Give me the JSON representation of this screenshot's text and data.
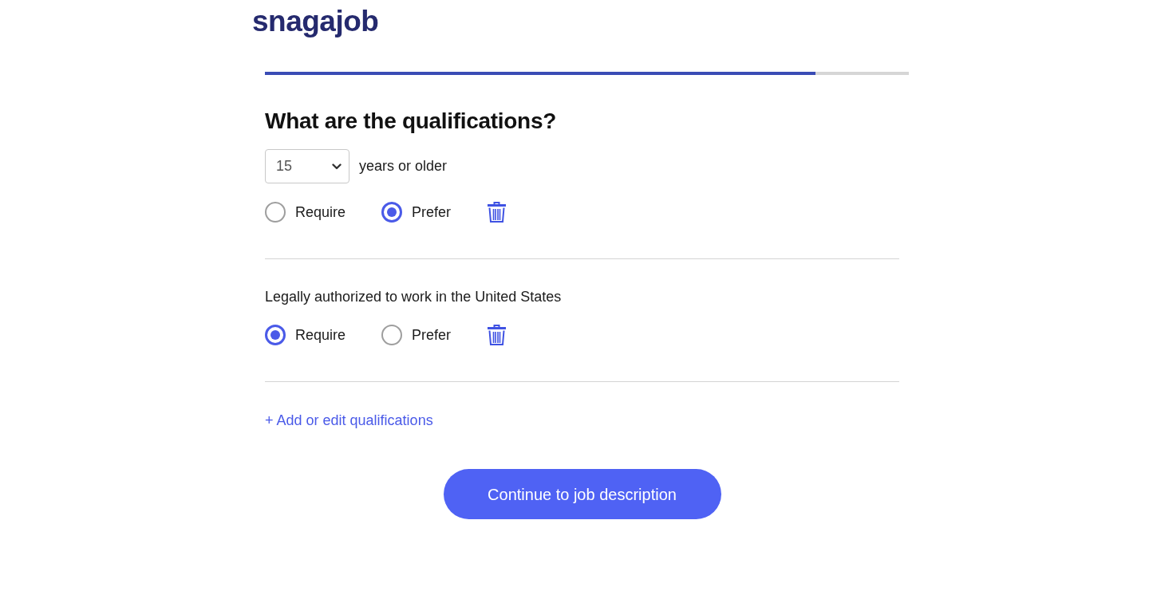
{
  "logo": "snagajob",
  "progress": {
    "level": 0.855
  },
  "heading": "What are the qualifications?",
  "qualifications": [
    {
      "kind": "age",
      "select": {
        "value": "15"
      },
      "suffix": "years or older",
      "options": [
        {
          "label": "Require",
          "selected": false
        },
        {
          "label": "Prefer",
          "selected": true
        }
      ]
    },
    {
      "kind": "text",
      "label": "Legally authorized to work in the United States",
      "options": [
        {
          "label": "Require",
          "selected": true
        },
        {
          "label": "Prefer",
          "selected": false
        }
      ]
    }
  ],
  "add_link": "+ Add or edit qualifications",
  "continue_button": "Continue to job description"
}
